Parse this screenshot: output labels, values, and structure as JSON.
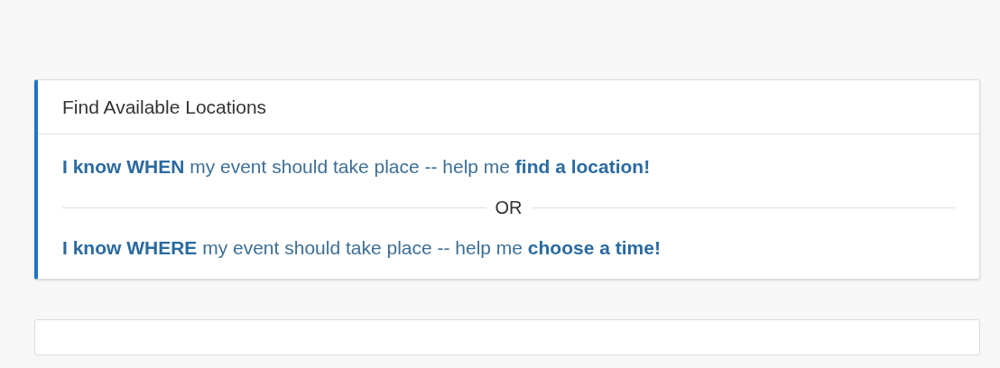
{
  "card": {
    "title": "Find Available Locations",
    "options": [
      {
        "kind": "link",
        "text": "**I know WHEN** my event should take place -- help me **find a location!**"
      },
      {
        "kind": "divider",
        "text": "OR"
      },
      {
        "kind": "link",
        "text": "**I know WHERE** my event should take place -- help me **choose a time!**"
      }
    ]
  }
}
